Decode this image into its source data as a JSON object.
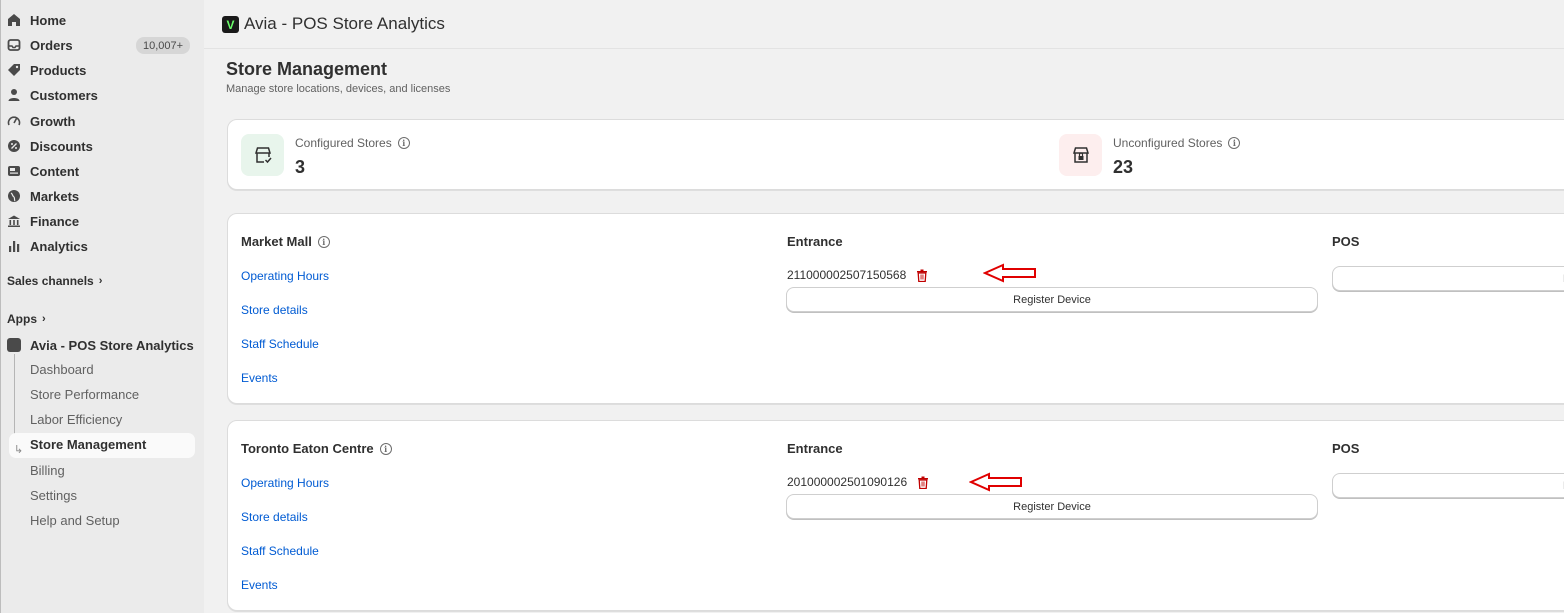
{
  "sidebar": {
    "nav": [
      {
        "label": "Home",
        "icon": "home-icon"
      },
      {
        "label": "Orders",
        "icon": "inbox-icon",
        "badge": "10,007+"
      },
      {
        "label": "Products",
        "icon": "tag-icon"
      },
      {
        "label": "Customers",
        "icon": "person-icon"
      },
      {
        "label": "Growth",
        "icon": "gauge-icon"
      },
      {
        "label": "Discounts",
        "icon": "discount-icon"
      },
      {
        "label": "Content",
        "icon": "content-icon"
      },
      {
        "label": "Markets",
        "icon": "globe-icon"
      },
      {
        "label": "Finance",
        "icon": "bank-icon"
      },
      {
        "label": "Analytics",
        "icon": "bar-chart-icon"
      }
    ],
    "sales_channels": "Sales channels",
    "apps": "Apps",
    "app_name": "Avia - POS Store Analytics",
    "app_subitems": [
      "Dashboard",
      "Store Performance",
      "Labor Efficiency",
      "Store Management",
      "Billing",
      "Settings",
      "Help and Setup"
    ],
    "active_subitem": "Store Management"
  },
  "topbar": {
    "title": "Avia - POS Store Analytics"
  },
  "page": {
    "title": "Store Management",
    "subtitle": "Manage store locations, devices, and licenses"
  },
  "stats": {
    "configured": {
      "label": "Configured Stores",
      "value": "3"
    },
    "unconfigured": {
      "label": "Unconfigured Stores",
      "value": "23"
    }
  },
  "stores": [
    {
      "name": "Market Mall",
      "links": [
        "Operating Hours",
        "Store details",
        "Staff Schedule",
        "Events"
      ],
      "entrance_label": "Entrance",
      "device_id": "211000002507150568",
      "register_label": "Register Device",
      "pos_label": "POS",
      "pos_button_partial": "Re"
    },
    {
      "name": "Toronto Eaton Centre",
      "links": [
        "Operating Hours",
        "Store details",
        "Staff Schedule",
        "Events"
      ],
      "entrance_label": "Entrance",
      "device_id": "201000002501090126",
      "register_label": "Register Device",
      "pos_label": "POS",
      "pos_button_partial": "Re"
    }
  ],
  "colors": {
    "link": "#005bd3",
    "danger": "#c00000",
    "annotation_arrow": "#e00000"
  }
}
